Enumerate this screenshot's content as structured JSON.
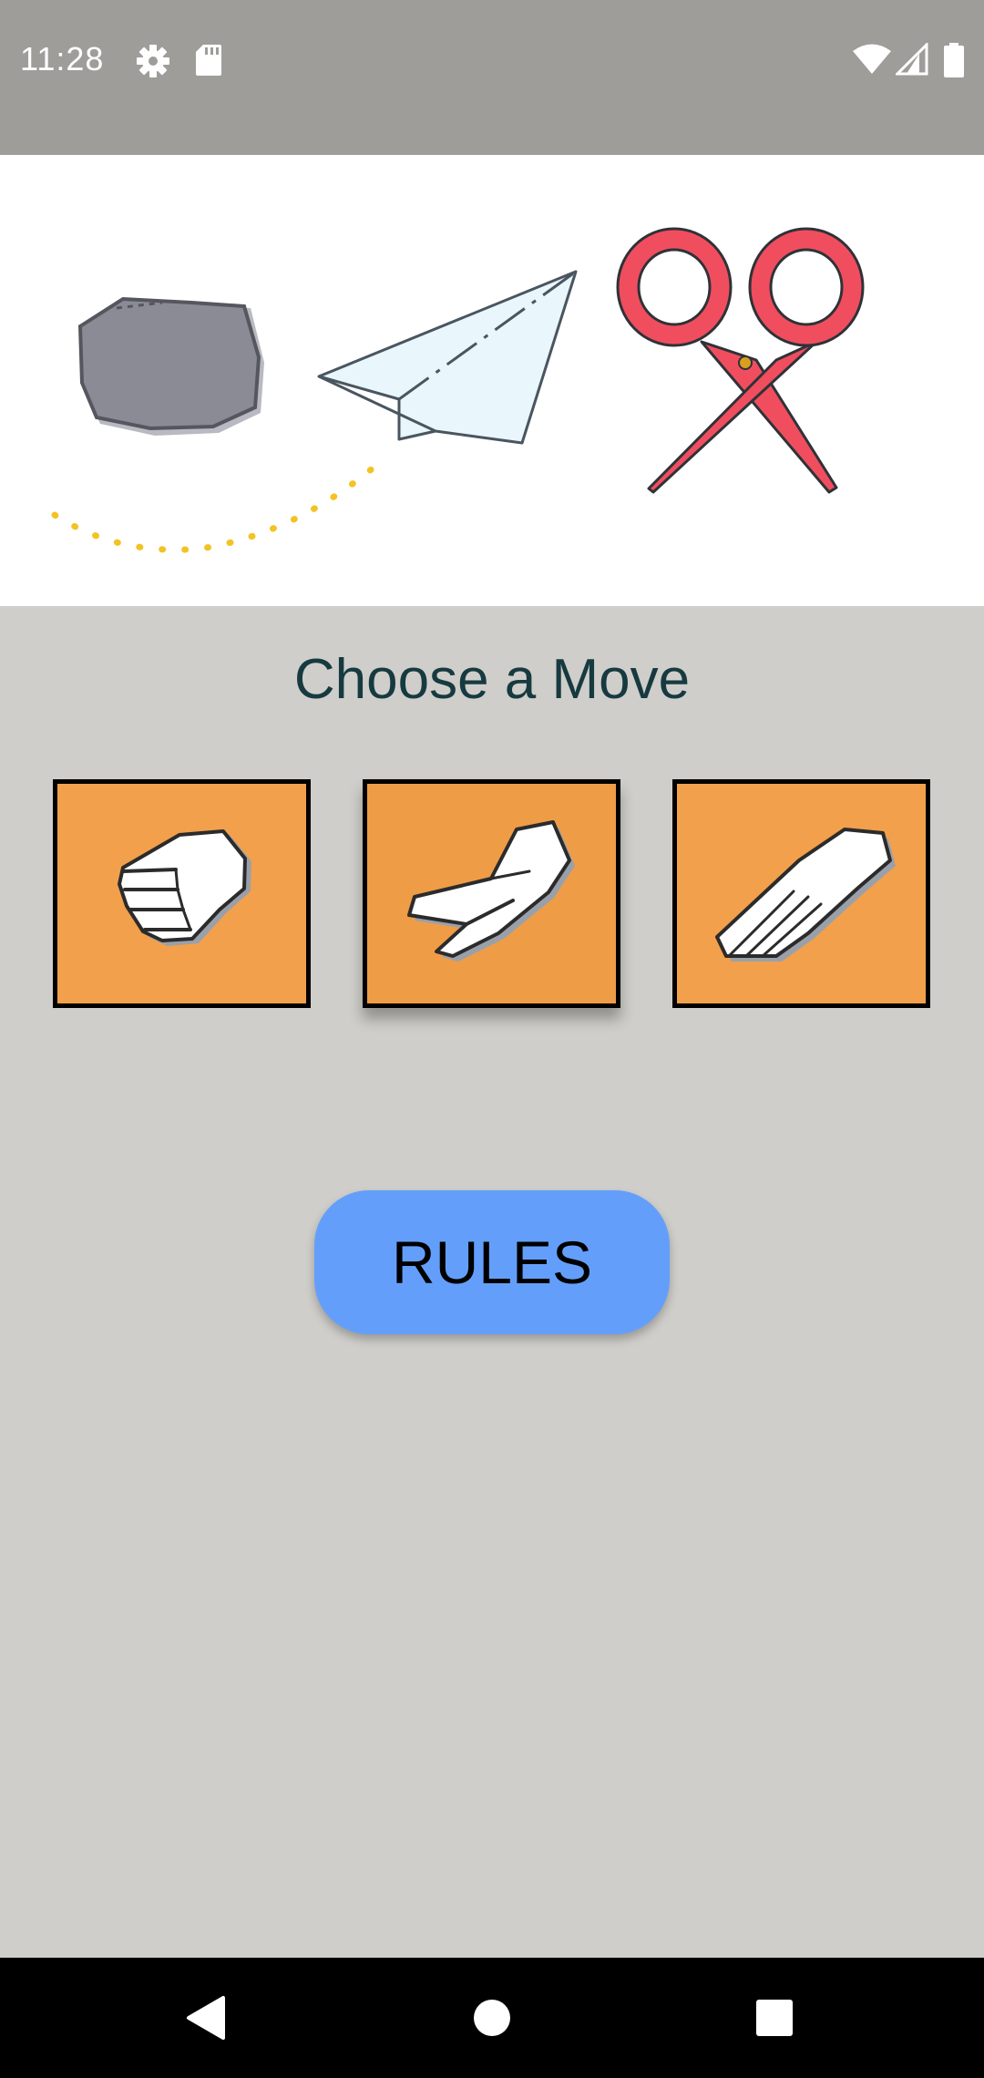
{
  "status_bar": {
    "time": "11:28",
    "left_icons": [
      "gear-icon",
      "sd-card-icon"
    ],
    "right_icons": [
      "wifi-icon",
      "cellular-signal-icon",
      "battery-icon"
    ]
  },
  "hero": {
    "illustration": [
      "rock-icon",
      "paper-plane-icon",
      "scissors-icon"
    ]
  },
  "main": {
    "heading": "Choose a Move",
    "moves": [
      {
        "id": "rock",
        "icon": "fist-hand-icon",
        "selected": false
      },
      {
        "id": "scissors",
        "icon": "peace-hand-icon",
        "selected": true
      },
      {
        "id": "paper",
        "icon": "open-hand-icon",
        "selected": false
      }
    ],
    "rules_label": "RULES"
  },
  "nav_bar": {
    "buttons": [
      "back-triangle-icon",
      "home-circle-icon",
      "recents-square-icon"
    ]
  },
  "colors": {
    "status_bar": "#9e9d99",
    "background": "#cfceca",
    "card": "#f2a04b",
    "rules_button": "#639ffa",
    "heading": "#163a40",
    "scissors": "#f04e5e",
    "rock": "#8a8b95"
  }
}
